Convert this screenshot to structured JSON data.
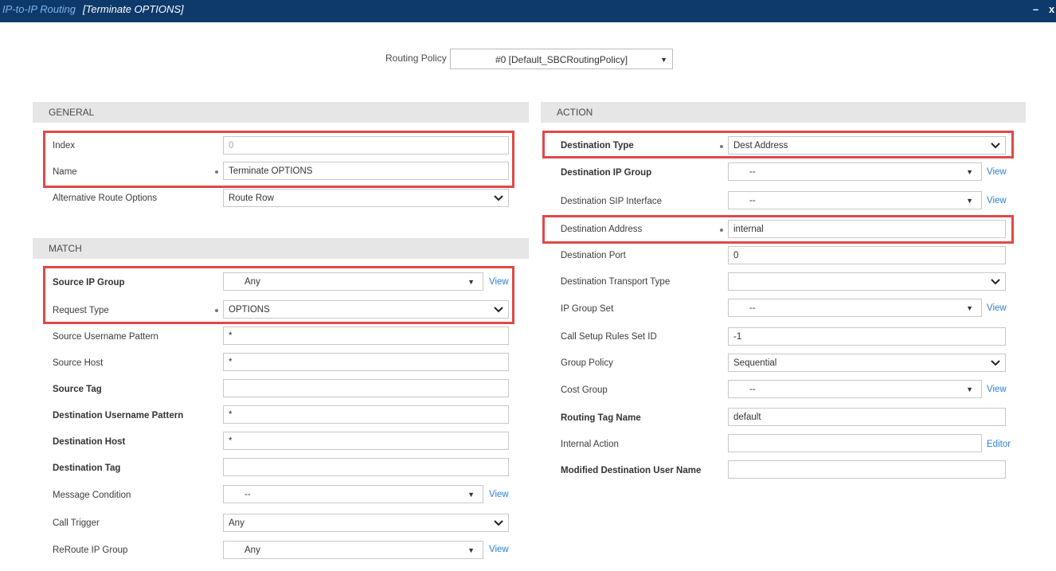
{
  "window": {
    "module": "IP-to-IP Routing",
    "record": "[Terminate OPTIONS]",
    "minimize": "–",
    "close": "x"
  },
  "routing_policy": {
    "label": "Routing Policy",
    "value": "#0 [Default_SBCRoutingPolicy]"
  },
  "general": {
    "title": "GENERAL",
    "index": {
      "label": "Index",
      "value": "0"
    },
    "name": {
      "label": "Name",
      "value": "Terminate OPTIONS"
    },
    "alt_route": {
      "label": "Alternative Route Options",
      "value": "Route Row"
    }
  },
  "match": {
    "title": "MATCH",
    "source_ip_group": {
      "label": "Source IP Group",
      "value": "Any",
      "link": "View"
    },
    "request_type": {
      "label": "Request Type",
      "value": "OPTIONS"
    },
    "source_username_pattern": {
      "label": "Source Username Pattern",
      "value": "*"
    },
    "source_host": {
      "label": "Source Host",
      "value": "*"
    },
    "source_tag": {
      "label": "Source Tag",
      "value": ""
    },
    "dest_username_pattern": {
      "label": "Destination Username Pattern",
      "value": "*"
    },
    "dest_host": {
      "label": "Destination Host",
      "value": "*"
    },
    "dest_tag": {
      "label": "Destination Tag",
      "value": ""
    },
    "message_condition": {
      "label": "Message Condition",
      "value": "--",
      "link": "View"
    },
    "call_trigger": {
      "label": "Call Trigger",
      "value": "Any"
    },
    "reroute_ip_group": {
      "label": "ReRoute IP Group",
      "value": "Any",
      "link": "View"
    }
  },
  "action": {
    "title": "ACTION",
    "destination_type": {
      "label": "Destination Type",
      "value": "Dest Address"
    },
    "destination_ip_group": {
      "label": "Destination IP Group",
      "value": "--",
      "link": "View"
    },
    "destination_sip_interface": {
      "label": "Destination SIP Interface",
      "value": "--",
      "link": "View"
    },
    "destination_address": {
      "label": "Destination Address",
      "value": "internal"
    },
    "destination_port": {
      "label": "Destination Port",
      "value": "0"
    },
    "destination_transport_type": {
      "label": "Destination Transport Type",
      "value": ""
    },
    "ip_group_set": {
      "label": "IP Group Set",
      "value": "--",
      "link": "View"
    },
    "call_setup_rules_set_id": {
      "label": "Call Setup Rules Set ID",
      "value": "-1"
    },
    "group_policy": {
      "label": "Group Policy",
      "value": "Sequential"
    },
    "cost_group": {
      "label": "Cost Group",
      "value": "--",
      "link": "View"
    },
    "routing_tag_name": {
      "label": "Routing Tag Name",
      "value": "default"
    },
    "internal_action": {
      "label": "Internal Action",
      "value": "",
      "link": "Editor"
    },
    "modified_destination_user_name": {
      "label": "Modified Destination User Name",
      "value": ""
    }
  },
  "colors": {
    "titlebar": "#0d3a6b",
    "highlight": "#e04848",
    "link": "#2a7fd4",
    "section": "#e6e6e6"
  }
}
